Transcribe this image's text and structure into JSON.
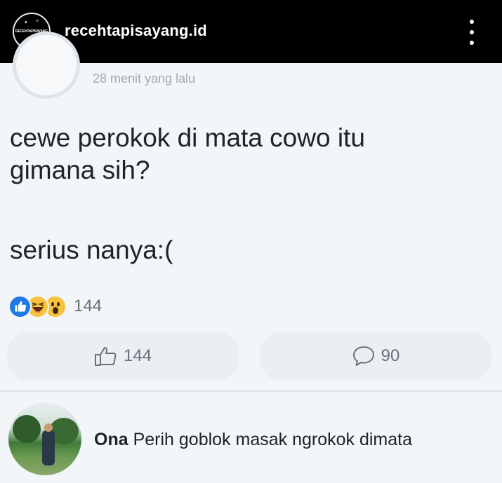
{
  "header": {
    "username": "recehtapisayang.id",
    "logo_text": "RECEHTAPISAYANG"
  },
  "post": {
    "timestamp": "28 menit yang lalu",
    "text_line1": "cewe perokok di mata cowo itu",
    "text_line2": "gimana sih?",
    "text_line3": "serius nanya:(",
    "reaction_count": "144",
    "reactions": [
      "like",
      "haha",
      "wow"
    ],
    "like_count": "144",
    "comment_count": "90"
  },
  "comment": {
    "author": "Ona",
    "text": "Perih goblok masak ngrokok dimata"
  },
  "colors": {
    "topbar": "#000000",
    "like_blue": "#1f7ae6",
    "emoji_yellow": "#f7c23c",
    "text": "#202226",
    "muted": "#6a7078"
  }
}
